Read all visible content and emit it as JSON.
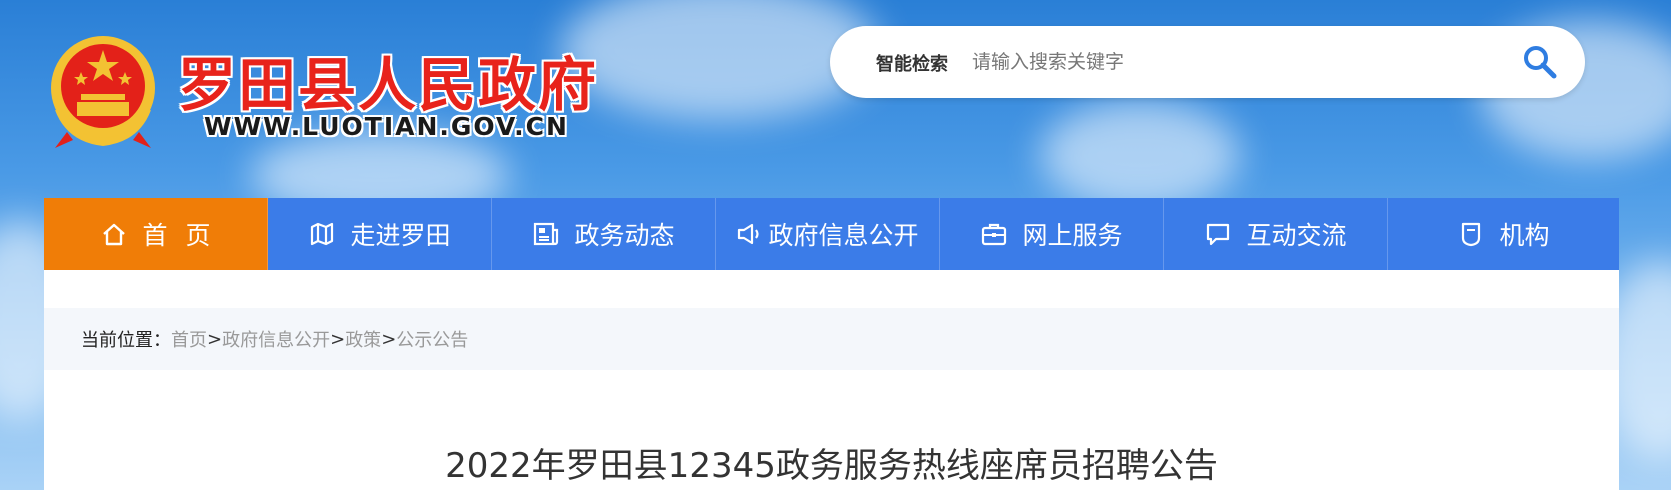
{
  "header": {
    "site_title": "罗田县人民政府",
    "site_url": "WWW.LUOTIAN.GOV.CN"
  },
  "search": {
    "label": "智能检索",
    "placeholder": "请输入搜索关键字",
    "value": ""
  },
  "nav": {
    "items": [
      {
        "label": "首页",
        "icon": "home-icon"
      },
      {
        "label": "走进罗田",
        "icon": "map-icon"
      },
      {
        "label": "政务动态",
        "icon": "news-icon"
      },
      {
        "label": "政府信息公开",
        "icon": "megaphone-icon"
      },
      {
        "label": "网上服务",
        "icon": "briefcase-icon"
      },
      {
        "label": "互动交流",
        "icon": "chat-icon"
      },
      {
        "label": "机构",
        "icon": "organization-icon"
      }
    ]
  },
  "breadcrumb": {
    "prefix": "当前位置：",
    "items": [
      "首页",
      "政府信息公开",
      "政策",
      "公示公告"
    ],
    "separator": ">"
  },
  "article": {
    "title": "2022年罗田县12345政务服务热线座席员招聘公告"
  },
  "colors": {
    "nav_bg": "#3b7ce8",
    "nav_active": "#f07d07",
    "title_red": "#e8231b"
  }
}
